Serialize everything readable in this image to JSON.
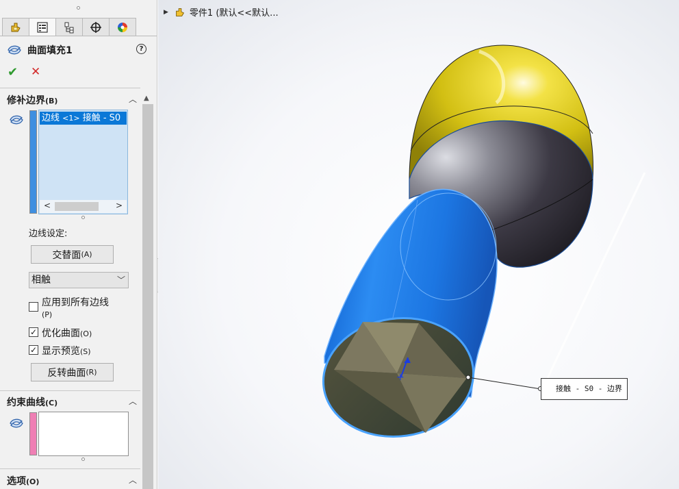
{
  "panel": {
    "tabs": [
      {
        "icon": "feature-manager-icon"
      },
      {
        "icon": "property-manager-icon"
      },
      {
        "icon": "configuration-manager-icon"
      },
      {
        "icon": "dimxpert-icon"
      },
      {
        "icon": "display-manager-icon"
      }
    ],
    "title": "曲面填充1",
    "help": "?",
    "ok": "✔",
    "cancel": "✕",
    "patch_boundary": {
      "title": "修补边界",
      "key": "(B)",
      "selected_item_prefix": "边线",
      "selected_item_small": "<1>",
      "selected_item_suffix": " 接触 - S0",
      "edge_settings_label": "边线设定:",
      "alternate_face_label": "交替面",
      "alternate_face_key": "(A)",
      "tangency_value": "相触",
      "apply_all": {
        "label": "应用到所有边线",
        "key": "(P)",
        "checked": false
      },
      "optimize": {
        "label": "优化曲面",
        "key": "(O)",
        "checked": true
      },
      "show_preview": {
        "label": "显示预览",
        "key": "(S)",
        "checked": true
      },
      "reverse_label": "反转曲面",
      "reverse_key": "(R)"
    },
    "constraint_curves": {
      "title": "约束曲线",
      "key": "(C)"
    },
    "options": {
      "title": "选项",
      "key": "(O)"
    },
    "colors": {
      "boundary_bar": "#3f8fe0",
      "constraint_bar": "#ef7fb4",
      "selection": "#0b78d7"
    }
  },
  "viewport": {
    "tree_label": "零件1  (默认<<默认...",
    "callout": "接触 - S0 - 边界",
    "colors": {
      "yellow_body": "#d8c61a",
      "gray_body": "#3d3a42",
      "blue_tube": "#1f7be6",
      "fill_surface": "#6e6a52"
    }
  }
}
